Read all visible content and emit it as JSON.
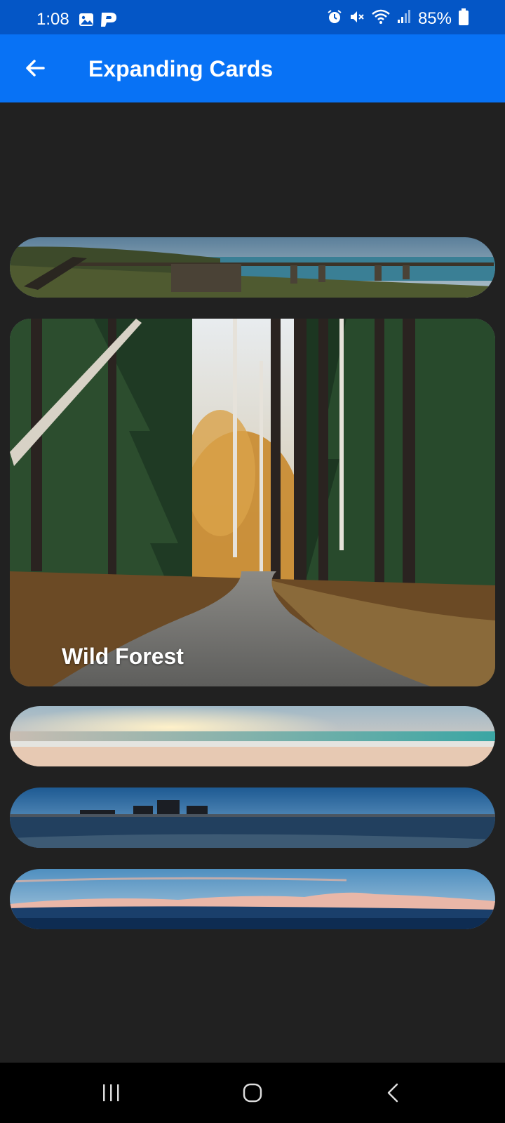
{
  "status_bar": {
    "time": "1:08",
    "battery": "85%",
    "left_icons": [
      "image-icon",
      "parking-app-icon"
    ],
    "right_icons": [
      "alarm-icon",
      "mute-icon",
      "wifi-icon",
      "signal-icon",
      "battery-icon"
    ]
  },
  "app_bar": {
    "title": "Expanding Cards",
    "back_icon": "back-arrow-icon",
    "color": "#0872f5"
  },
  "cards": [
    {
      "title": "",
      "scene": "coastal pier",
      "expanded": false
    },
    {
      "title": "Wild Forest",
      "scene": "forest road",
      "expanded": true
    },
    {
      "title": "",
      "scene": "beach sunset",
      "expanded": false
    },
    {
      "title": "",
      "scene": "city waterfront",
      "expanded": false
    },
    {
      "title": "",
      "scene": "mountains",
      "expanded": false
    }
  ],
  "nav_bar": {
    "items": [
      "recent-apps-icon",
      "home-icon",
      "back-icon"
    ]
  }
}
